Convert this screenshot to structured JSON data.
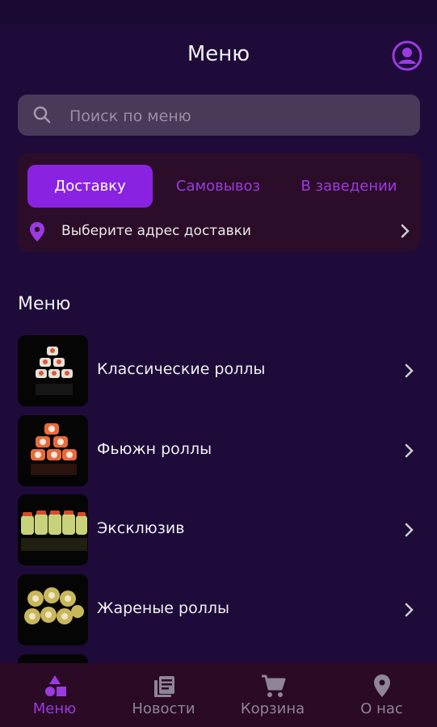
{
  "header": {
    "title": "Меню"
  },
  "search": {
    "placeholder": "Поиск по меню"
  },
  "delivery": {
    "tabs": [
      "Доставку",
      "Самовывоз",
      "В заведении"
    ],
    "address_prompt": "Выберите адрес доставки"
  },
  "menu": {
    "section_title": "Меню",
    "items": [
      {
        "label": "Классические роллы"
      },
      {
        "label": "Фьюжн роллы"
      },
      {
        "label": "Эксклюзив"
      },
      {
        "label": "Жареные роллы"
      }
    ]
  },
  "nav": {
    "items": [
      {
        "label": "Меню",
        "icon": "shapes-icon"
      },
      {
        "label": "Новости",
        "icon": "news-icon"
      },
      {
        "label": "Корзина",
        "icon": "cart-icon"
      },
      {
        "label": "О нас",
        "icon": "location-pin-icon"
      }
    ]
  },
  "colors": {
    "background": "#1e0b3a",
    "accent": "#8a22e2",
    "card": "#2c0d29",
    "search_bg": "#4a3a5a"
  }
}
